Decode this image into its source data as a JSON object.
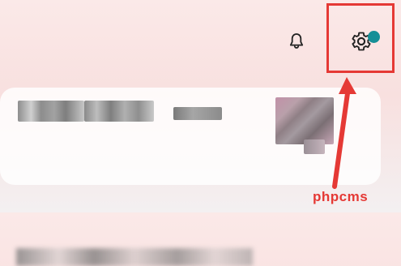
{
  "header": {
    "icons": {
      "bell": "bell-icon",
      "settings": "gear-icon",
      "settings_badge": "notification-dot"
    }
  },
  "watermark": {
    "text": "phpcms"
  },
  "colors": {
    "highlight": "#e53935",
    "badge": "#168f97"
  }
}
